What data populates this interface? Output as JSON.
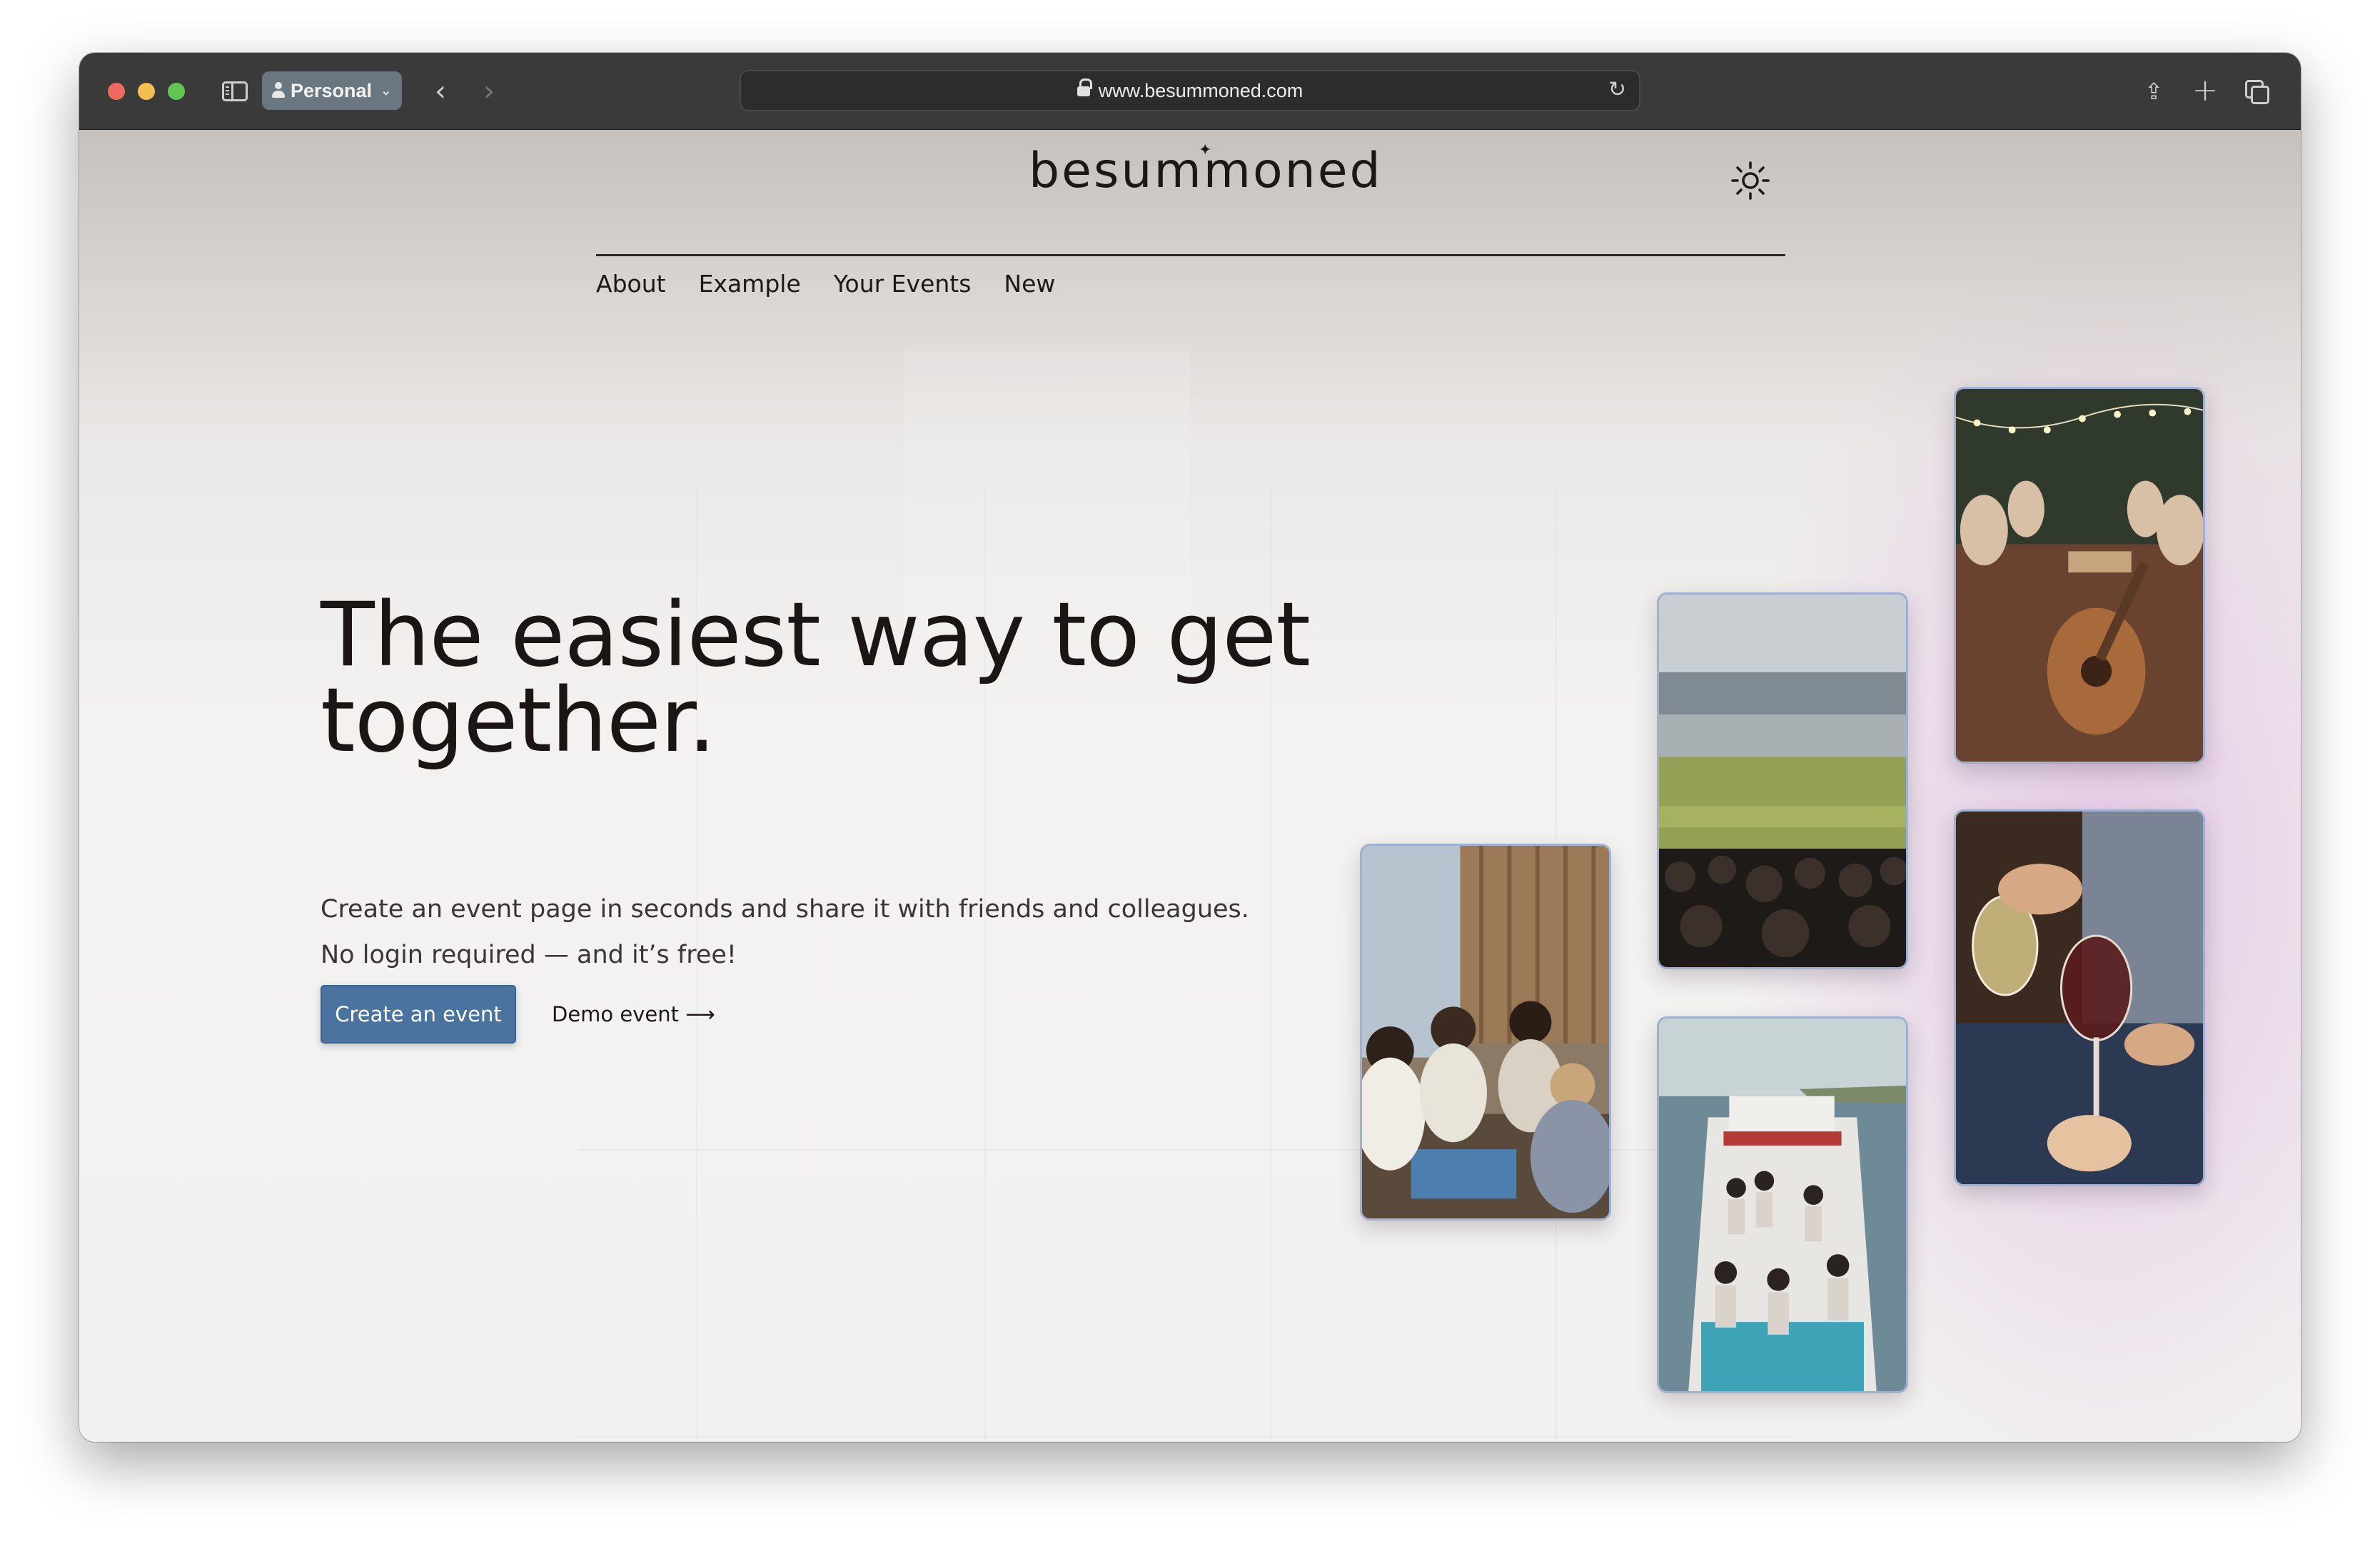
{
  "browser": {
    "profile_label": "Personal",
    "url": "www.besummoned.com",
    "icons": [
      "sidebar-icon",
      "person-icon",
      "back-arrow-icon",
      "forward-arrow-icon",
      "lock-icon",
      "reload-icon",
      "share-icon",
      "new-tab-plus-icon",
      "tab-overview-icon"
    ]
  },
  "site": {
    "logo_text": "besummoned",
    "theme_toggle_icon": "sun-icon",
    "nav": [
      "About",
      "Example",
      "Your Events",
      "New"
    ]
  },
  "hero": {
    "title_line1": "The easiest way to get",
    "title_line2": "together.",
    "subtitle_line1": "Create an event page in seconds and share it with friends and colleagues.",
    "subtitle_line2": "No login required — and it’s free!",
    "primary_button": "Create an event",
    "secondary_link": "Demo event ⟶"
  },
  "colors": {
    "primary_button": "#4a73a0",
    "text": "#1b1614",
    "accent_glow": "#d8aadc"
  }
}
